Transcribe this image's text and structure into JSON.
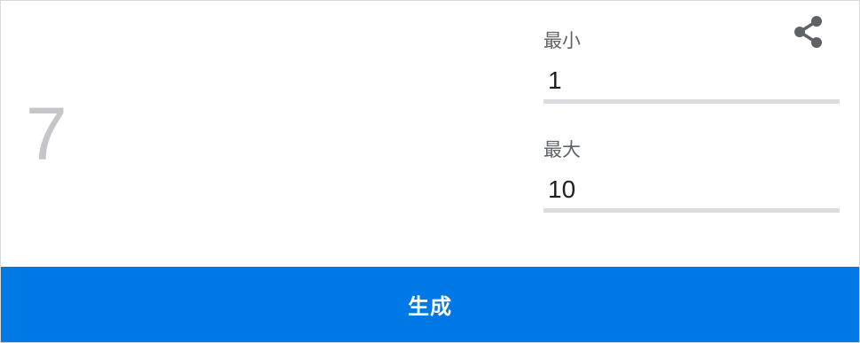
{
  "result": {
    "value": "7"
  },
  "share": {
    "icon": "share-icon",
    "color": "#5f6368"
  },
  "min_field": {
    "label": "最小",
    "value": "1"
  },
  "max_field": {
    "label": "最大",
    "value": "10"
  },
  "generate_button": {
    "label": "生成",
    "background": "#0079e6"
  }
}
